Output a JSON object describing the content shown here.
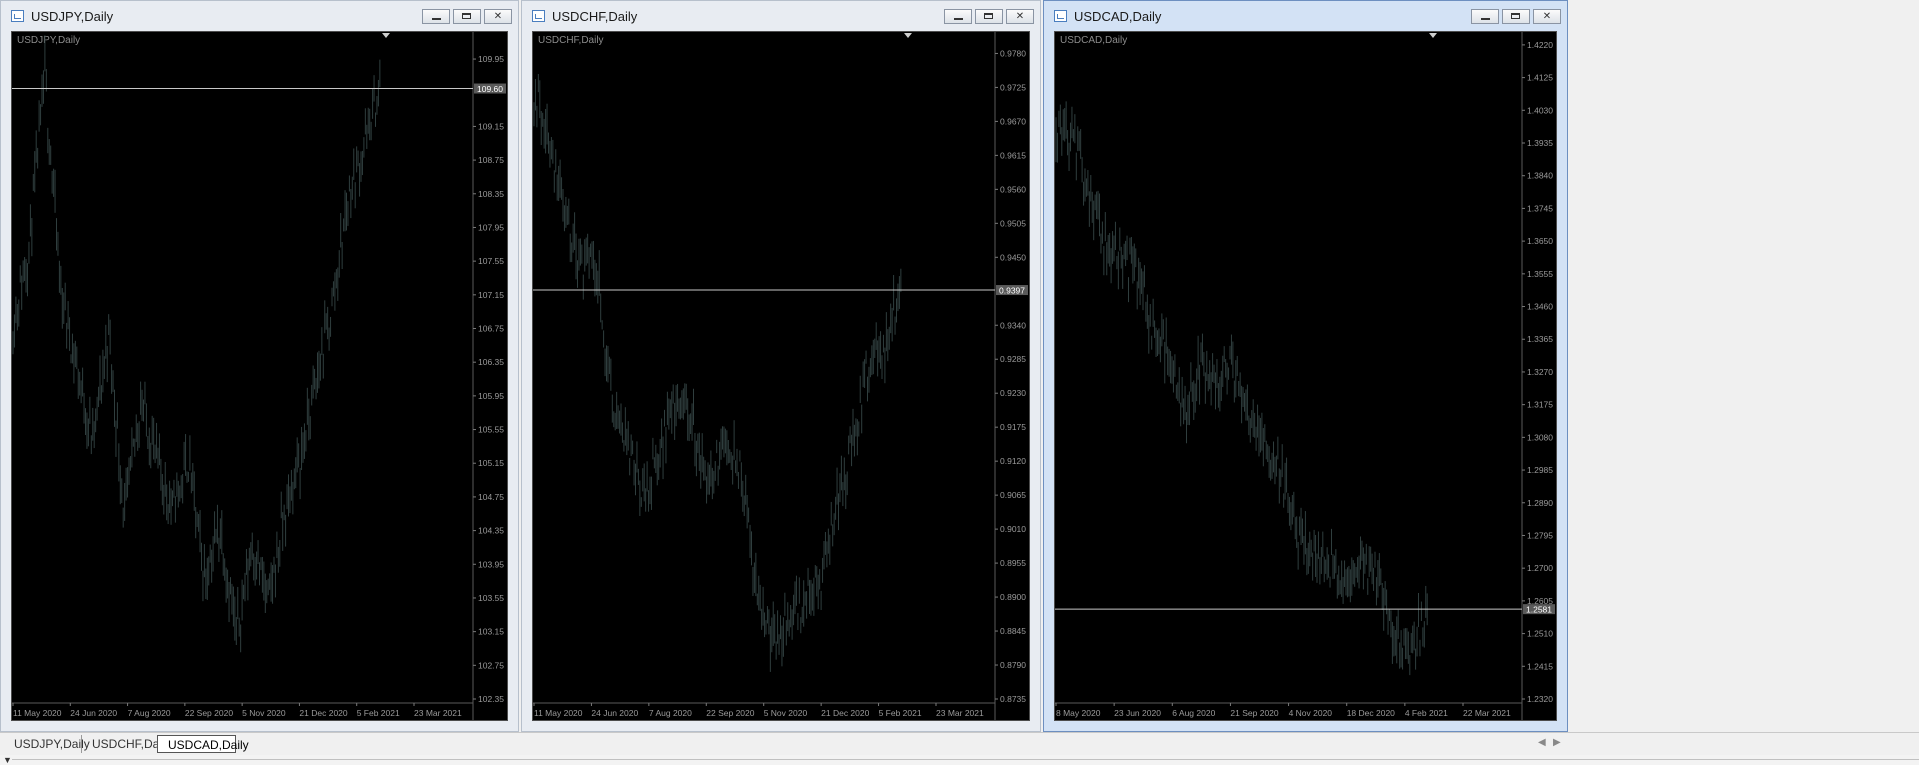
{
  "windows": [
    {
      "id": "usdjpy",
      "title": "USDJPY,Daily",
      "symbol_label": "USDJPY,Daily",
      "active": false,
      "chart_data": {
        "type": "bar",
        "symbol": "USDJPY",
        "timeframe": "Daily",
        "ylim": [
          102.35,
          110.2
        ],
        "y_ticks": [
          "109.95",
          "109.15",
          "108.75",
          "108.35",
          "107.95",
          "107.55",
          "107.15",
          "106.75",
          "106.35",
          "105.95",
          "105.55",
          "105.15",
          "104.75",
          "104.35",
          "103.95",
          "103.55",
          "103.15",
          "102.75",
          "102.35"
        ],
        "x_ticks": [
          "11 May 2020",
          "24 Jun 2020",
          "7 Aug 2020",
          "22 Sep 2020",
          "5 Nov 2020",
          "21 Dec 2020",
          "5 Feb 2021",
          "23 Mar 2021"
        ],
        "current_price": "109.60",
        "price_anchors": [
          106.8,
          107.7,
          109.75,
          107.2,
          106.3,
          105.4,
          106.7,
          104.5,
          105.9,
          105.2,
          104.6,
          105.2,
          103.8,
          104.4,
          103.1,
          104.2,
          103.5,
          104.5,
          105.2,
          106.1,
          107.0,
          108.3,
          108.9,
          109.6
        ],
        "grid": false
      }
    },
    {
      "id": "usdchf",
      "title": "USDCHF,Daily",
      "symbol_label": "USDCHF,Daily",
      "active": false,
      "chart_data": {
        "type": "bar",
        "symbol": "USDCHF",
        "timeframe": "Daily",
        "ylim": [
          0.8735,
          0.9805
        ],
        "y_ticks": [
          "0.9780",
          "0.9725",
          "0.9670",
          "0.9615",
          "0.9560",
          "0.9505",
          "0.9450",
          "0.9340",
          "0.9285",
          "0.9230",
          "0.9175",
          "0.9120",
          "0.9065",
          "0.9010",
          "0.8955",
          "0.8900",
          "0.8845",
          "0.8790",
          "0.8735"
        ],
        "x_ticks": [
          "11 May 2020",
          "24 Jun 2020",
          "7 Aug 2020",
          "22 Sep 2020",
          "5 Nov 2020",
          "21 Dec 2020",
          "5 Feb 2021",
          "23 Mar 2021"
        ],
        "current_price": "0.9397",
        "price_anchors": [
          0.972,
          0.964,
          0.95,
          0.944,
          0.942,
          0.92,
          0.912,
          0.907,
          0.915,
          0.923,
          0.917,
          0.908,
          0.916,
          0.91,
          0.89,
          0.883,
          0.887,
          0.89,
          0.892,
          0.905,
          0.915,
          0.928,
          0.931,
          0.9397
        ],
        "grid": false
      }
    },
    {
      "id": "usdcad",
      "title": "USDCAD,Daily",
      "symbol_label": "USDCAD,Daily",
      "active": true,
      "chart_data": {
        "type": "bar",
        "symbol": "USDCAD",
        "timeframe": "Daily",
        "ylim": [
          1.232,
          1.424
        ],
        "y_ticks": [
          "1.4220",
          "1.4125",
          "1.4030",
          "1.3935",
          "1.3840",
          "1.3745",
          "1.3650",
          "1.3555",
          "1.3460",
          "1.3365",
          "1.3270",
          "1.3175",
          "1.3080",
          "1.2985",
          "1.2890",
          "1.2795",
          "1.2700",
          "1.2605",
          "1.2510",
          "1.2415",
          "1.2320"
        ],
        "x_ticks": [
          "8 May 2020",
          "23 Jun 2020",
          "6 Aug 2020",
          "21 Sep 2020",
          "4 Nov 2020",
          "18 Dec 2020",
          "4 Feb 2021",
          "22 Mar 2021"
        ],
        "current_price": "1.2581",
        "price_anchors": [
          1.4,
          1.395,
          1.38,
          1.365,
          1.36,
          1.355,
          1.34,
          1.33,
          1.315,
          1.33,
          1.325,
          1.328,
          1.315,
          1.305,
          1.295,
          1.28,
          1.275,
          1.27,
          1.268,
          1.272,
          1.265,
          1.25,
          1.245,
          1.2581
        ],
        "grid": false
      }
    }
  ],
  "tabs": [
    {
      "label": "USDJPY,Daily",
      "active": false
    },
    {
      "label": "USDCHF,Daily",
      "active": false
    },
    {
      "label": "USDCAD,Daily",
      "active": true
    }
  ],
  "colors": {
    "bar_color": "#2f3e3e",
    "current_line": "#c8c8c8",
    "price_tag_bg": "#5a5a5a",
    "axis_text": "#9a9a9a"
  },
  "icons": [
    "chart-window-icon",
    "minimize-icon",
    "maximize-icon",
    "close-icon",
    "tab-scroll-left-icon",
    "tab-scroll-right-icon"
  ]
}
